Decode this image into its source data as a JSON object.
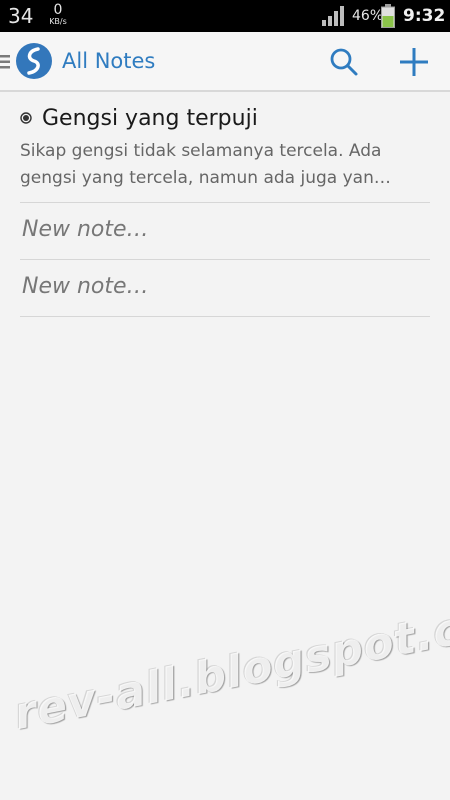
{
  "status_bar": {
    "left_number": "34",
    "net_speed": "0",
    "net_unit": "KB/s",
    "battery_percent": "46%",
    "time": "9:32",
    "icons": [
      "signal-icon",
      "battery-icon"
    ],
    "battery_color": "#8bc34a"
  },
  "app_bar": {
    "title": "All Notes",
    "icons": [
      "up-indicator-icon",
      "app-logo-icon",
      "search-icon",
      "add-icon"
    ],
    "accent_color": "#2f7cc0"
  },
  "notes": [
    {
      "title": "Gengsi yang terpuji",
      "preview_line1": "Sikap gengsi tidak selamanya tercela. Ada",
      "preview_line2": "gengsi yang tercela, namun ada juga yan…",
      "icon": "pinned-dot-icon"
    }
  ],
  "placeholders": [
    "New note…",
    "New note…"
  ],
  "watermark": "rev-all.blogspot.com"
}
